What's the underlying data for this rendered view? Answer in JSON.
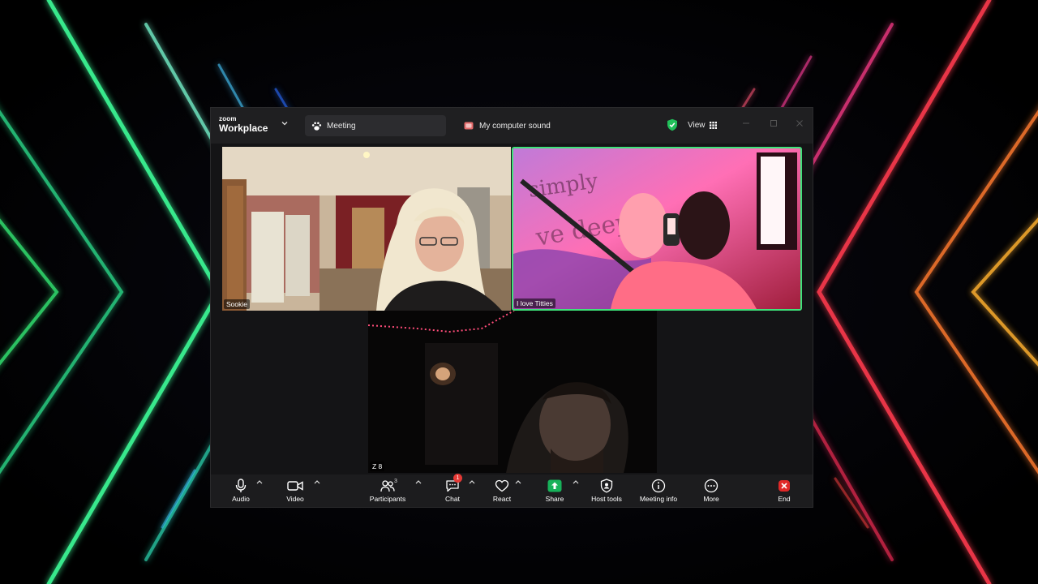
{
  "app": {
    "brand_small": "zoom",
    "brand_name": "Workplace"
  },
  "titlebar": {
    "tabs": [
      {
        "label": "Meeting",
        "icon": "paw-icon"
      },
      {
        "label": "My computer sound",
        "icon": "audio-share-icon"
      }
    ],
    "view_label": "View",
    "security_color": "#21c05a"
  },
  "participants": [
    {
      "name": "Sookie"
    },
    {
      "name": "I love Titties",
      "active_speaker": true,
      "highlight_color": "#3ee37a"
    },
    {
      "name": "Z 8"
    }
  ],
  "toolbar": {
    "audio": "Audio",
    "video": "Video",
    "participants": "Participants",
    "participant_count": "3",
    "chat": "Chat",
    "chat_badge": "1",
    "react": "React",
    "share": "Share",
    "host_tools": "Host tools",
    "meeting_info": "Meeting info",
    "more": "More",
    "end": "End",
    "share_color": "#17b25a",
    "end_color": "#e02828"
  }
}
